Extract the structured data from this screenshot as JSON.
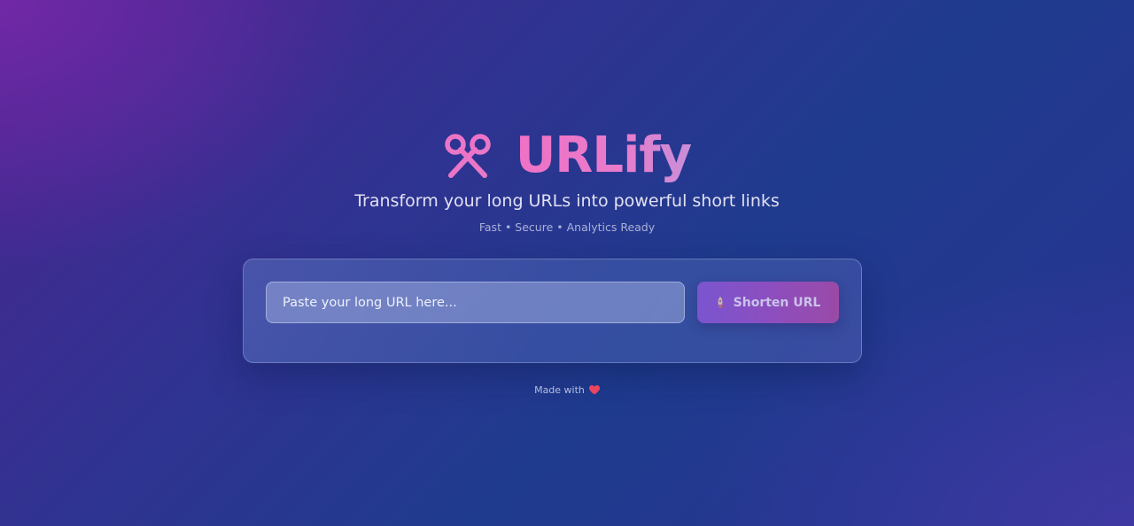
{
  "brand": {
    "name": "URLify",
    "icon": "scissors-icon",
    "gradient_start": "#ee72c6",
    "gradient_end": "#c88fd9"
  },
  "hero": {
    "tagline": "Transform your long URLs into powerful short links",
    "features": "Fast • Secure • Analytics Ready"
  },
  "form": {
    "input_placeholder": "Paste your long URL here...",
    "input_value": "",
    "button_label": "Shorten URL",
    "button_icon": "rocket-icon"
  },
  "footer": {
    "text": "Made with",
    "icon": "heart-icon",
    "heart_color": "#e8455f"
  },
  "colors": {
    "background_primary": "#2f3391",
    "background_accent": "#4a2590",
    "button_start": "#7a55cf",
    "button_end": "#9a4aa7"
  }
}
